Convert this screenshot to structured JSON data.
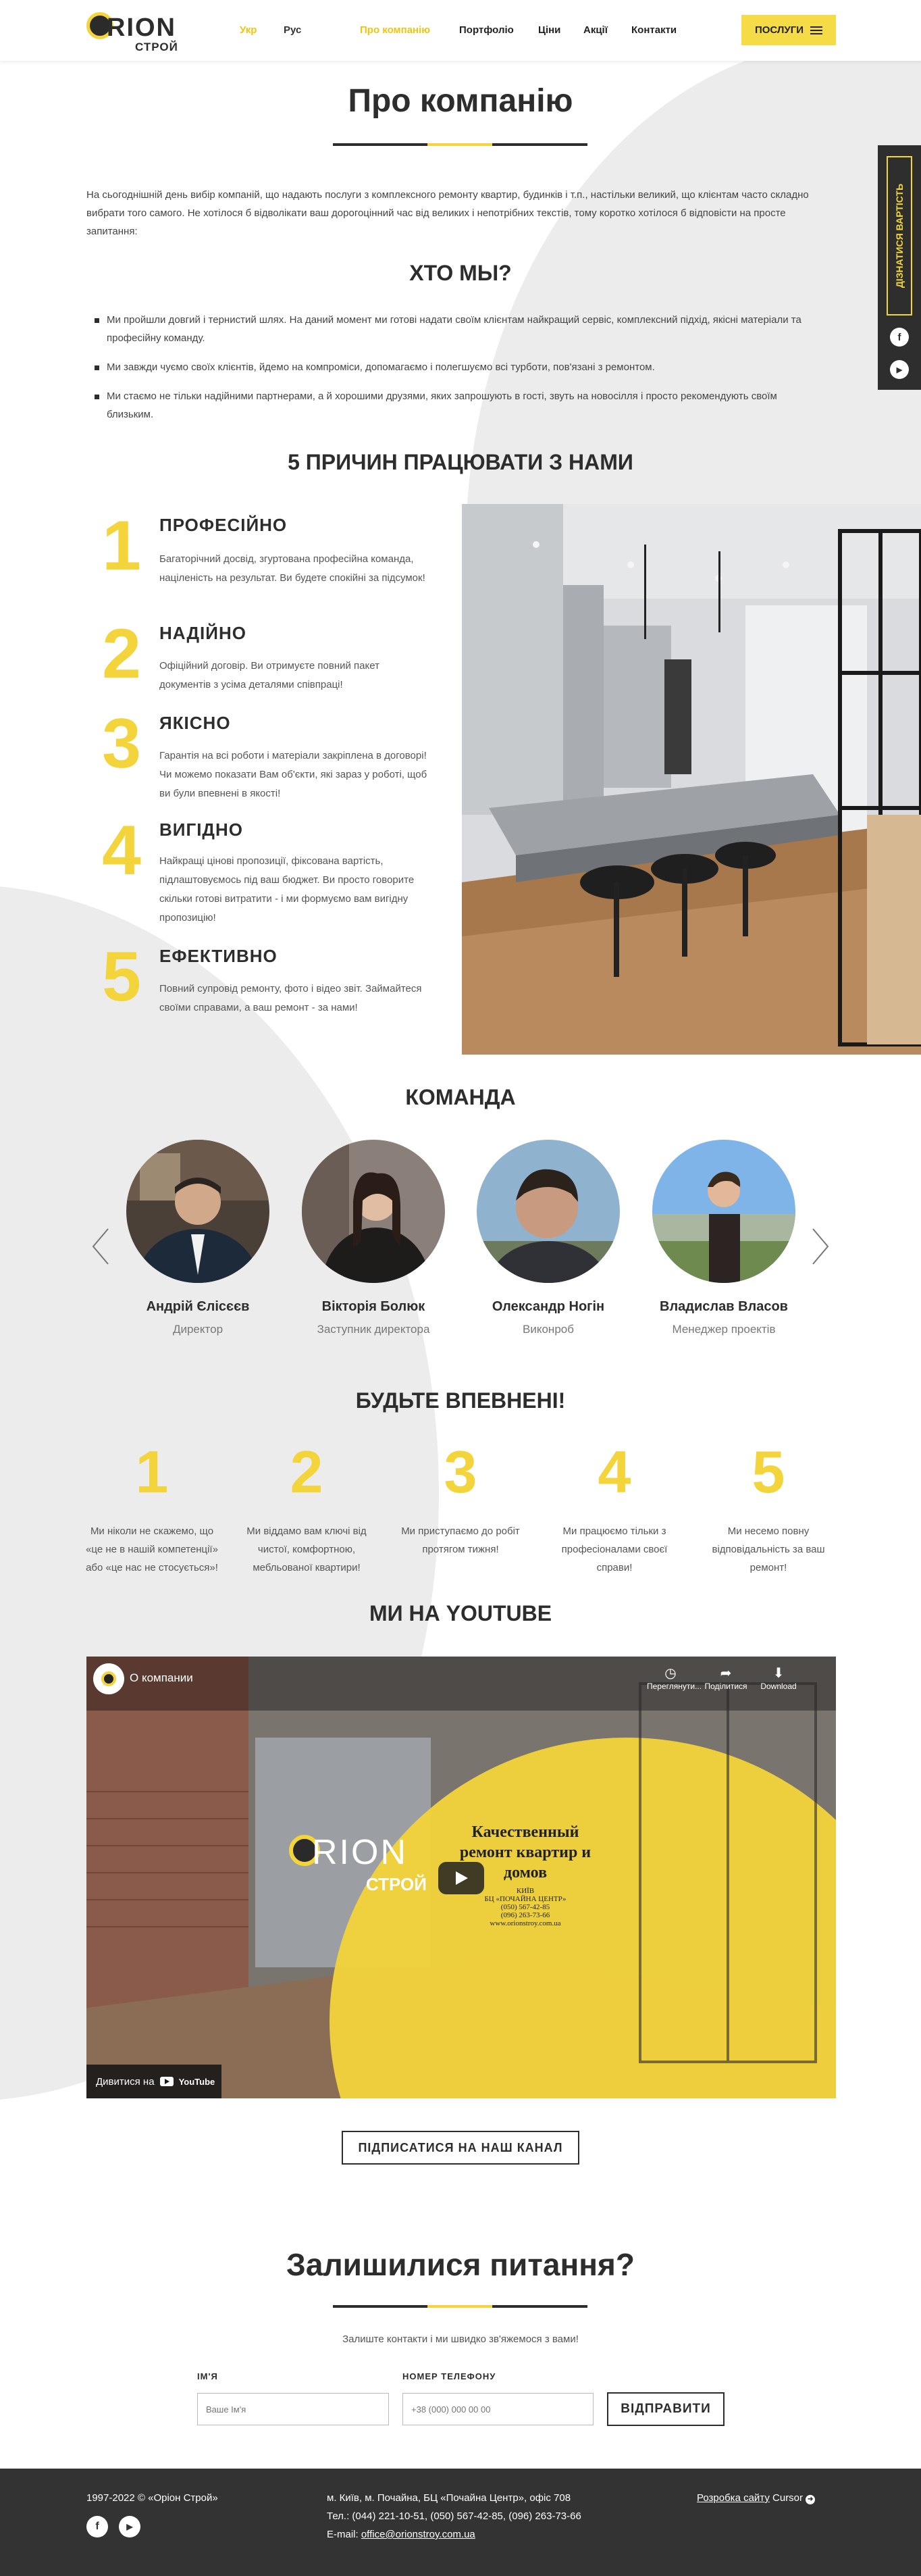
{
  "header": {
    "logo_word": "RION",
    "logo_sub": "СТРОЙ",
    "lang_uk": "Укр",
    "lang_ru": "Рус",
    "nav": [
      "Про компанію",
      "Портфоліо",
      "Ціни",
      "Акції",
      "Контакти"
    ],
    "services_label": "ПОСЛУГИ"
  },
  "side_panel": {
    "cta": "ДІЗНАТИСЯ ВАРТІСТЬ",
    "facebook": "f",
    "youtube": "▶"
  },
  "about": {
    "title": "Про компанію",
    "intro": "На сьогоднішній день вибір компаній, що надають послуги з комплексного ремонту квартир, будинків і т.п., настільки великий, що клієнтам часто складно вибрати того самого. Не хотілося б відволікати ваш дорогоцінний час від великих і непотрібних текстів, тому коротко хотілося б відповісти на просте запитання:",
    "who_title": "ХТО МЫ?",
    "bullets": [
      "Ми пройшли довгий і тернистий шлях. На даний момент ми готові надати своїм клієнтам найкращий сервіс, комплексний підхід, якісні матеріали та професійну команду.",
      "Ми завжди чуємо своїх клієнтів, йдемо на компроміси, допомагаємо і полегшуємо всі турботи, пов'язані з ремонтом.",
      "Ми стаємо не тільки надійними партнерами, а й хорошими друзями, яких запрошують в гості, звуть на новосілля і просто рекомендують своїм близьким."
    ]
  },
  "reasons": {
    "title": "5 ПРИЧИН ПРАЦЮВАТИ З НАМИ",
    "items": [
      {
        "num": "1",
        "title": "ПРОФЕСІЙНО",
        "text": "Багаторічний досвід, згуртована професійна команда, націленість на результат. Ви будете спокійні за підсумок!"
      },
      {
        "num": "2",
        "title": "НАДІЙНО",
        "text": "Офіційний договір. Ви отримуєте повний пакет документів з усіма деталями співпраці!"
      },
      {
        "num": "3",
        "title": "ЯКІСНО",
        "text": "Гарантія на всі роботи і матеріали закріплена в договорі! Чи можемо показати Вам об'єкти, які зараз у роботі, щоб ви були впевнені в якості!"
      },
      {
        "num": "4",
        "title": "ВИГІДНО",
        "text": "Найкращі цінові пропозиції, фіксована вартість, підлаштовуємось під ваш бюджет. Ви просто говорите скільки готові витратити - і ми формуємо вам вигідну пропозицію!"
      },
      {
        "num": "5",
        "title": "ЕФЕКТИВНО",
        "text": "Повний супровід ремонту, фото і відео звіт. Займайтеся своїми справами, а ваш ремонт - за нами!"
      }
    ]
  },
  "team": {
    "title": "КОМАНДА",
    "members": [
      {
        "name": "Андрій Єлісєєв",
        "role": "Директор"
      },
      {
        "name": "Вікторія Болюк",
        "role": "Заступник директора"
      },
      {
        "name": "Олександр Ногін",
        "role": "Виконроб"
      },
      {
        "name": "Владислав Власов",
        "role": "Менеджер проектів"
      }
    ]
  },
  "be_sure": {
    "title": "БУДЬТЕ ВПЕВНЕНІ!",
    "items": [
      {
        "num": "1",
        "text": "Ми ніколи не скажемо, що «це не в нашій компетенції» або «це нас не стосується»!"
      },
      {
        "num": "2",
        "text": "Ми віддамо вам ключі від чистої, комфортною, мебльованої квартири!"
      },
      {
        "num": "3",
        "text": "Ми приступаємо до робіт протягом тижня!"
      },
      {
        "num": "4",
        "text": "Ми працюємо тільки з професіоналами своєї справи!"
      },
      {
        "num": "5",
        "text": "Ми несемо повну відповідальність за ваш ремонт!"
      }
    ]
  },
  "youtube": {
    "title": "МИ НА YOUTUBE",
    "video_title": "О компании",
    "watch_later": "Переглянути...",
    "share": "Поділитися",
    "download": "Download",
    "overlay_heading": "Качественный ремонт квартир и домов",
    "overlay_city": "КИЇВ",
    "overlay_bc": "БЦ «ПОЧАЙНА ЦЕНТР»",
    "overlay_phones": [
      "(050) 567-42-85",
      "(096) 263-73-66"
    ],
    "overlay_site": "www.orionstroy.com.ua",
    "logo_word": "RION",
    "logo_sub": "СТРОЙ",
    "watch_on": "Дивитися на",
    "yt_logo": "YouTube",
    "subscribe": "ПІДПИСАТИСЯ НА НАШ КАНАЛ"
  },
  "contact_form": {
    "title": "Залишилися питання?",
    "subtitle": "Залиште контакти і ми швидко зв'яжемося з вами!",
    "name_label": "ІМ'Я",
    "name_placeholder": "Ваше Ім'я",
    "phone_label": "НОМЕР ТЕЛЕФОНУ",
    "phone_placeholder": "+38 (000) 000 00 00",
    "send": "ВІДПРАВИТИ"
  },
  "footer": {
    "copyright": "1997-2022 © «Оріон Строй»",
    "address": "м. Київ, м. Почайна, БЦ «Почайна Центр», офіс 708",
    "phones": "Тел.: (044) 221-10-51, (050) 567-42-85, (096) 263-73-66",
    "email_label": "E-mail:",
    "email": "office@orionstroy.com.ua",
    "dev_link": "Розробка сайту",
    "dev_name": "Cursor"
  },
  "colors": {
    "accent": "#f3d43b",
    "dark": "#2d2d2d",
    "footer_bg": "#333333"
  }
}
